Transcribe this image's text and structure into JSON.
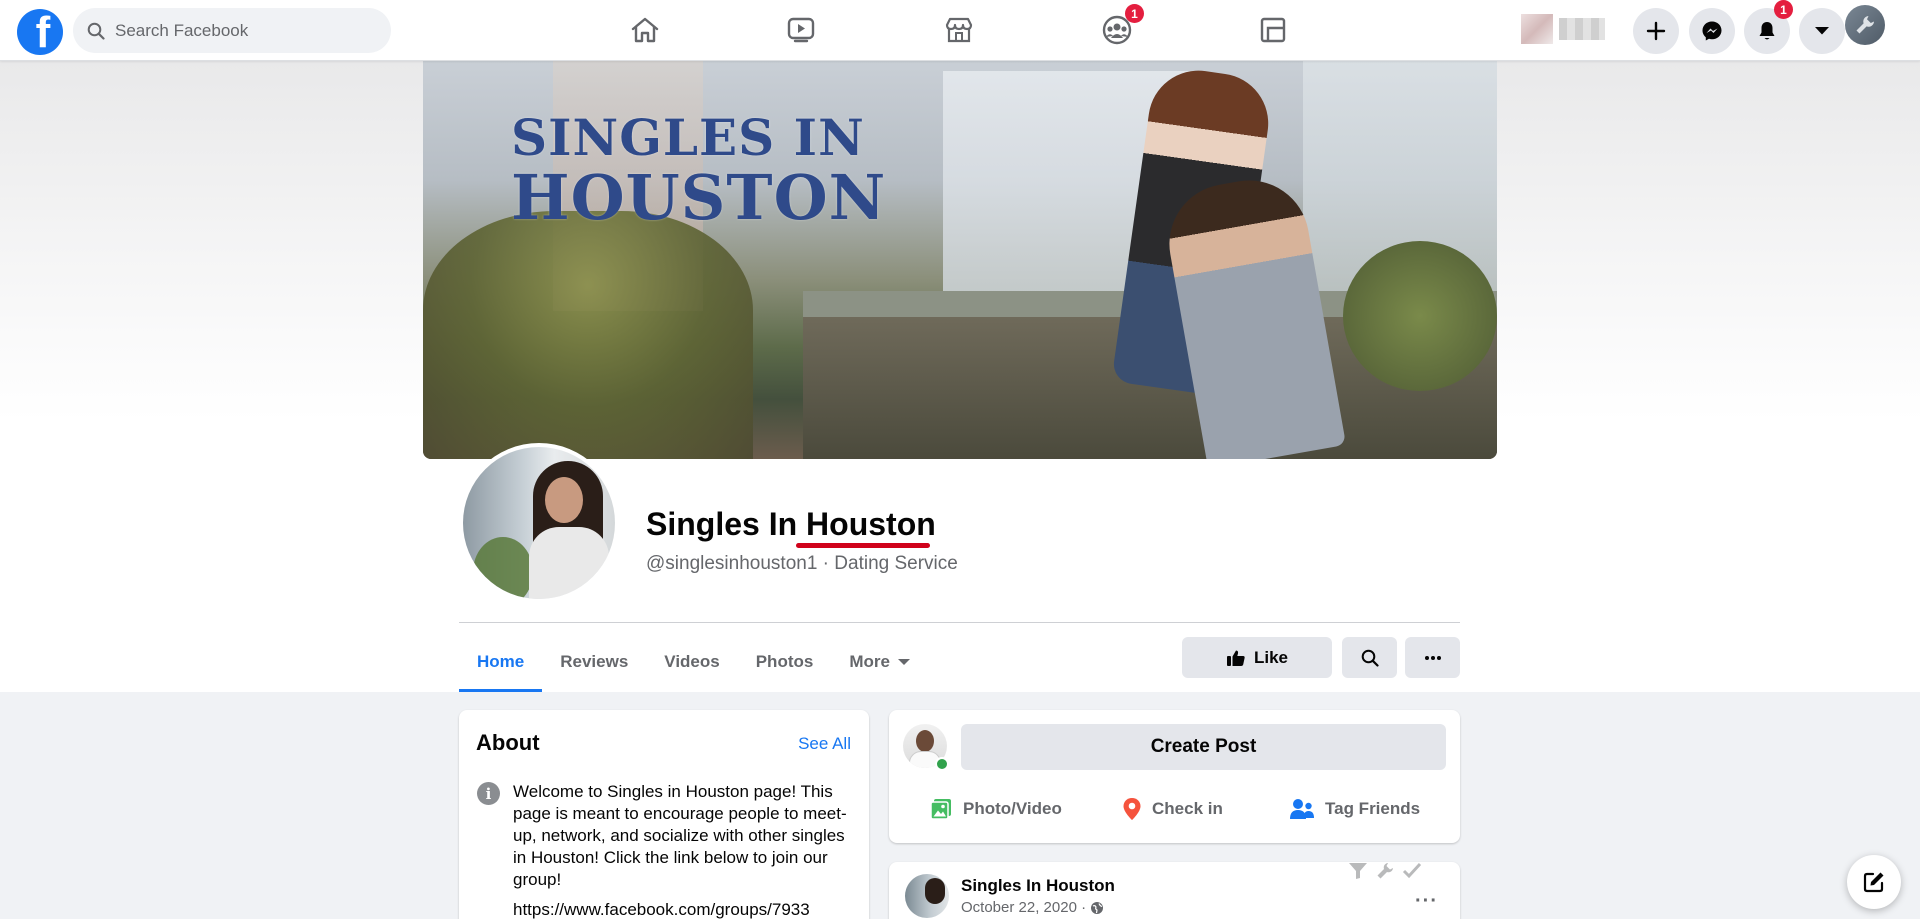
{
  "topbar": {
    "logo_icon": "facebook-logo",
    "search_placeholder": "Search Facebook",
    "nav": [
      {
        "icon": "home-icon"
      },
      {
        "icon": "watch-icon"
      },
      {
        "icon": "marketplace-icon"
      },
      {
        "icon": "groups-icon",
        "badge": "1"
      },
      {
        "icon": "gaming-icon"
      }
    ],
    "actions": [
      {
        "icon": "plus-icon"
      },
      {
        "icon": "messenger-icon"
      },
      {
        "icon": "bell-icon",
        "badge": "1"
      },
      {
        "icon": "caret-down-icon"
      },
      {
        "icon": "wrench-icon"
      }
    ]
  },
  "cover": {
    "title_line1": "SINGLES IN",
    "title_line2": "HOUSTON"
  },
  "page": {
    "name": "Singles In Houston",
    "handle_category": "@singlesinhouston1 · Dating Service"
  },
  "tabs": [
    {
      "label": "Home",
      "active": true
    },
    {
      "label": "Reviews"
    },
    {
      "label": "Videos"
    },
    {
      "label": "Photos"
    },
    {
      "label": "More"
    }
  ],
  "buttons": {
    "like_label": "Like"
  },
  "about": {
    "title": "About",
    "see_all": "See All",
    "description": "Welcome to Singles in Houston page! This page is meant to encourage people to meet-up, network, and socialize with other singles in Houston! Click the link below to join our group!",
    "link": "https://www.facebook.com/groups/7933"
  },
  "create_post": {
    "button_label": "Create Post",
    "actions": [
      {
        "label": "Photo/Video",
        "icon": "photo-icon"
      },
      {
        "label": "Check in",
        "icon": "location-pin-icon"
      },
      {
        "label": "Tag Friends",
        "icon": "tag-friends-icon"
      }
    ]
  },
  "post": {
    "author": "Singles In Houston",
    "date": "October 22, 2020 ·",
    "more": "···"
  },
  "colors": {
    "brand_blue": "#1877f2",
    "badge_red": "#e41e3f",
    "underline_red": "#d0021b",
    "online_green": "#31a24c"
  }
}
